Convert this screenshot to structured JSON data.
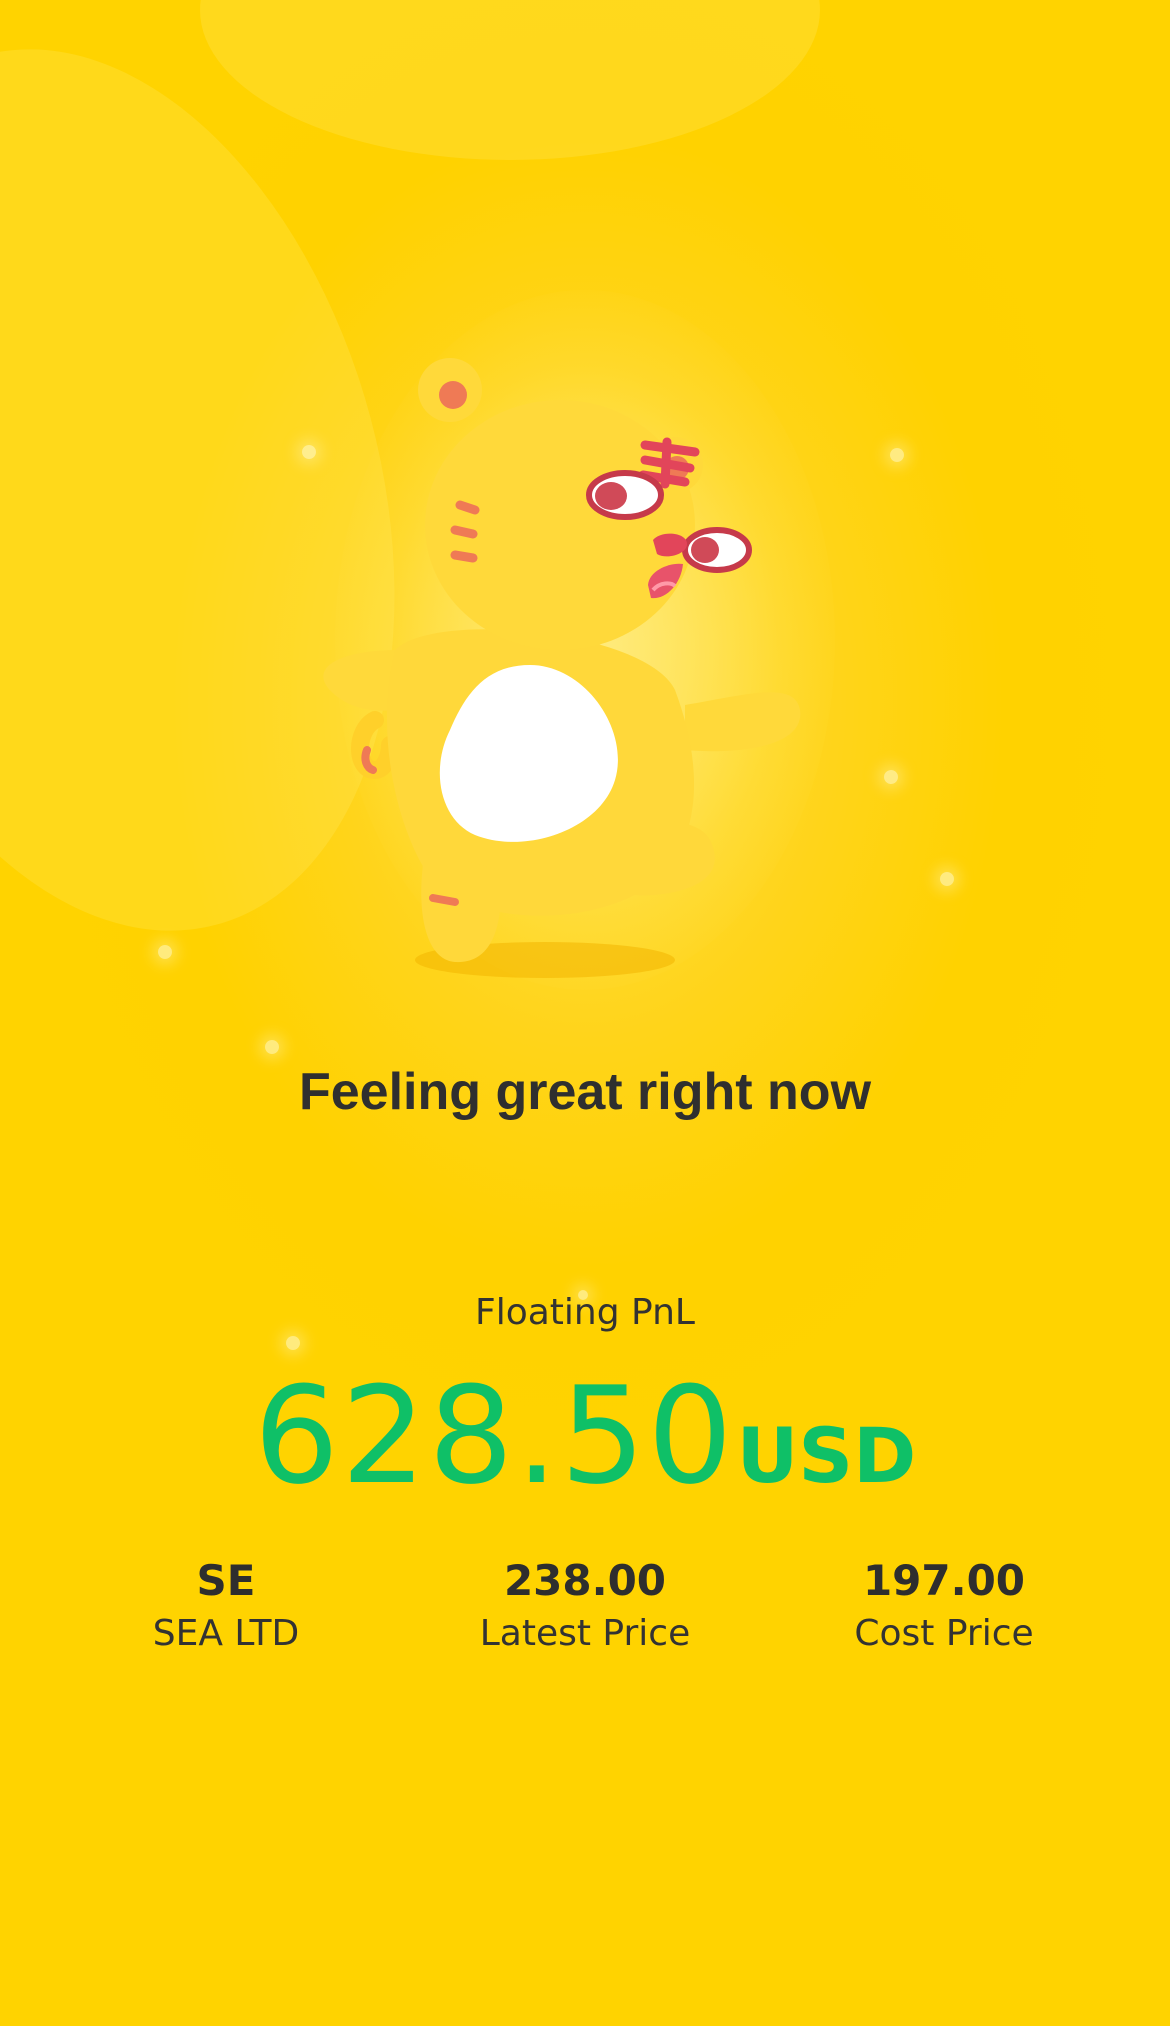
{
  "mascot": {
    "icon": "tiger-mascot-icon"
  },
  "headline": "Feeling great right now",
  "pnl": {
    "label": "Floating PnL",
    "value": "628.50",
    "currency": "USD",
    "color": "#0fc067"
  },
  "stats": [
    {
      "value": "SE",
      "label": "SEA LTD"
    },
    {
      "value": "238.00",
      "label": "Latest Price"
    },
    {
      "value": "197.00",
      "label": "Cost Price"
    }
  ],
  "colors": {
    "background": "#ffd300",
    "text": "#2f2f2f",
    "profit": "#0fc067"
  }
}
